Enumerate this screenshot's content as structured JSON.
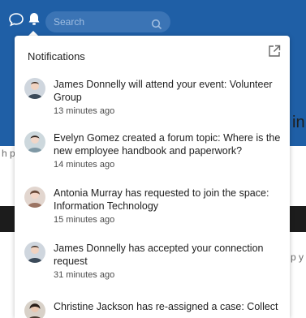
{
  "search": {
    "placeholder": "Search"
  },
  "notifications": {
    "title": "Notifications",
    "items": [
      {
        "text": "James Donnelly will attend your event: Volunteer Group",
        "time": "13 minutes ago",
        "avatar": "#6e7f92"
      },
      {
        "text": "Evelyn Gomez created a forum topic: Where is the new employee handbook and paperwork?",
        "time": "14 minutes ago",
        "avatar": "#8aa8b8"
      },
      {
        "text": "Antonia Murray has requested to join the space: Information Technology",
        "time": "15 minutes ago",
        "avatar": "#b08a72"
      },
      {
        "text": "James Donnelly has accepted your connection request",
        "time": "31 minutes ago",
        "avatar": "#6e7f92"
      },
      {
        "text": "Christine Jackson has re-assigned a case: Collect",
        "time": "",
        "avatar": "#5a4a3a"
      }
    ]
  },
  "background": {
    "right_text_1": "in",
    "right_text_2": "p y",
    "left_text": "h p"
  },
  "colors": {
    "header": "#1f5fa6",
    "search_bg": "#3b74b5"
  }
}
